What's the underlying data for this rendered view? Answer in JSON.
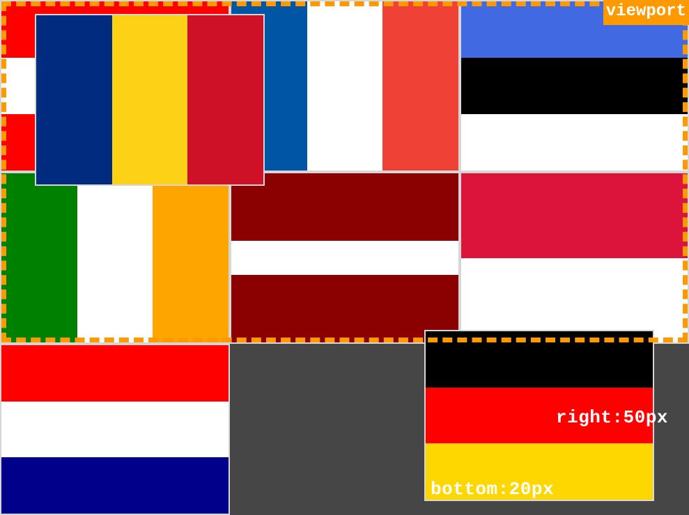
{
  "labels": {
    "viewport": "viewport",
    "right_offset": "right:50px",
    "bottom_offset": "bottom:20px"
  },
  "colors": {
    "background": "#464646",
    "viewport_outline": "#ff9900",
    "tile_border": "#d6d6d6"
  },
  "flags": [
    {
      "name": "austria-flag",
      "stripes": [
        "#ff0000",
        "#ffffff",
        "#ff0000"
      ]
    },
    {
      "name": "france-flag",
      "stripes": [
        "#0055a4",
        "#ffffff",
        "#ef4135"
      ]
    },
    {
      "name": "estonia-flag",
      "stripes": [
        "#4169e1",
        "#000000",
        "#ffffff"
      ]
    },
    {
      "name": "ireland-flag",
      "stripes": [
        "#008000",
        "#ffffff",
        "#ffa500"
      ]
    },
    {
      "name": "latvia-flag",
      "stripes": [
        "#8b0000",
        "#ffffff",
        "#8b0000"
      ]
    },
    {
      "name": "poland-flag",
      "stripes": [
        "#dc143c",
        "#ffffff"
      ]
    },
    {
      "name": "netherlands-flag",
      "stripes": [
        "#ff0000",
        "#ffffff",
        "#00008b"
      ]
    },
    {
      "name": "romania-flag",
      "stripes": [
        "#002b7f",
        "#fcd116",
        "#ce1126"
      ]
    },
    {
      "name": "germany-flag",
      "stripes": [
        "#000000",
        "#ff0000",
        "#ffd700"
      ]
    }
  ]
}
